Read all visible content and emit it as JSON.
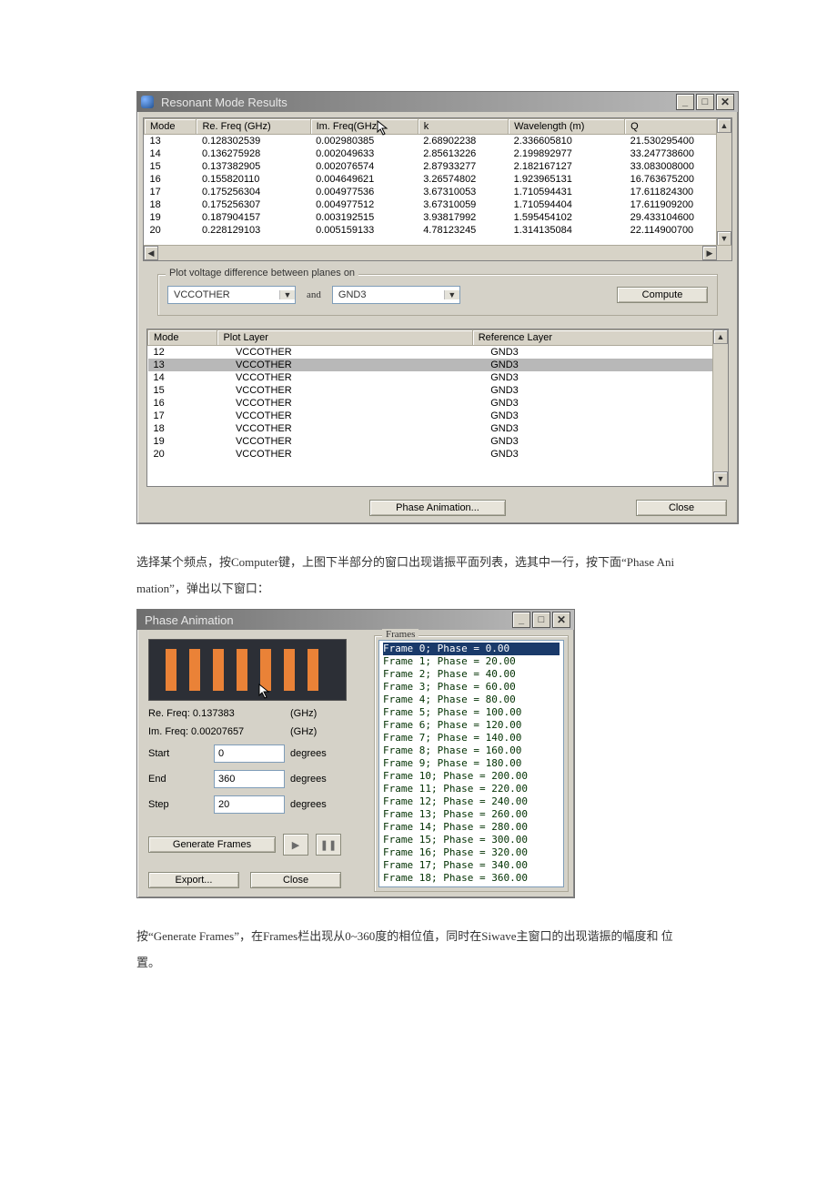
{
  "resonant_window": {
    "title": "Resonant Mode Results",
    "columns": [
      "Mode",
      "Re. Freq (GHz)",
      "Im. Freq(GHz)",
      "k",
      "Wavelength (m)",
      "Q"
    ],
    "rows": [
      [
        "13",
        "0.128302539",
        "0.002980385",
        "2.68902238",
        "2.336605810",
        "21.530295400"
      ],
      [
        "14",
        "0.136275928",
        "0.002049633",
        "2.85613226",
        "2.199892977",
        "33.247738600"
      ],
      [
        "15",
        "0.137382905",
        "0.002076574",
        "2.87933277",
        "2.182167127",
        "33.083008000"
      ],
      [
        "16",
        "0.155820110",
        "0.004649621",
        "3.26574802",
        "1.923965131",
        "16.763675200"
      ],
      [
        "17",
        "0.175256304",
        "0.004977536",
        "3.67310053",
        "1.710594431",
        "17.611824300"
      ],
      [
        "18",
        "0.175256307",
        "0.004977512",
        "3.67310059",
        "1.710594404",
        "17.611909200"
      ],
      [
        "19",
        "0.187904157",
        "0.003192515",
        "3.93817992",
        "1.595454102",
        "29.433104600"
      ],
      [
        "20",
        "0.228129103",
        "0.005159133",
        "4.78123245",
        "1.314135084",
        "22.114900700"
      ]
    ],
    "fieldset_label": "Plot voltage difference between planes on",
    "combo1": "VCCOTHER",
    "and_label": "and",
    "combo2": "GND3",
    "compute_label": "Compute",
    "lower_columns": [
      "Mode",
      "Plot Layer",
      "Reference Layer"
    ],
    "lower_rows": [
      [
        "12",
        "VCCOTHER",
        "GND3"
      ],
      [
        "13",
        "VCCOTHER",
        "GND3"
      ],
      [
        "14",
        "VCCOTHER",
        "GND3"
      ],
      [
        "15",
        "VCCOTHER",
        "GND3"
      ],
      [
        "16",
        "VCCOTHER",
        "GND3"
      ],
      [
        "17",
        "VCCOTHER",
        "GND3"
      ],
      [
        "18",
        "VCCOTHER",
        "GND3"
      ],
      [
        "19",
        "VCCOTHER",
        "GND3"
      ],
      [
        "20",
        "VCCOTHER",
        "GND3"
      ]
    ],
    "selected_lower_index": 1,
    "phase_anim_label": "Phase Animation...",
    "close_label": "Close"
  },
  "doc_paragraph_1a": "选择某个频点，按Computer键，上图下半部分的窗口出现谐振平面列表，选其中一行，按下面“Phase Ani",
  "doc_paragraph_1b": "mation”，弹出以下窗口：",
  "phase_anim_window": {
    "title": "Phase Animation",
    "re_label": "Re. Freq: 0.137383",
    "im_label": "Im. Freq: 0.00207657",
    "ghz": "(GHz)",
    "start_label": "Start",
    "start_value": "0",
    "end_label": "End",
    "end_value": "360",
    "step_label": "Step",
    "step_value": "20",
    "degrees": "degrees",
    "gen_frames_label": "Generate Frames",
    "export_label": "Export...",
    "close_label": "Close",
    "frames_label": "Frames",
    "frames": [
      "Frame 0; Phase = 0.00",
      "Frame 1; Phase = 20.00",
      "Frame 2; Phase = 40.00",
      "Frame 3; Phase = 60.00",
      "Frame 4; Phase = 80.00",
      "Frame 5; Phase = 100.00",
      "Frame 6; Phase = 120.00",
      "Frame 7; Phase = 140.00",
      "Frame 8; Phase = 160.00",
      "Frame 9; Phase = 180.00",
      "Frame 10; Phase = 200.00",
      "Frame 11; Phase = 220.00",
      "Frame 12; Phase = 240.00",
      "Frame 13; Phase = 260.00",
      "Frame 14; Phase = 280.00",
      "Frame 15; Phase = 300.00",
      "Frame 16; Phase = 320.00",
      "Frame 17; Phase = 340.00",
      "Frame 18; Phase = 360.00"
    ],
    "selected_frame_index": 0
  },
  "doc_paragraph_2a": "按“Generate Frames”，在Frames栏出现从0~360度的相位值，同时在Siwave主窗口的出现谐振的幅度和 位",
  "doc_paragraph_2b": "置。",
  "glyphs": {
    "min": "_",
    "max": "□",
    "close": "✕",
    "triUp": "▲",
    "triDown": "▼",
    "triLeft": "◀",
    "triRight": "▶",
    "play": "▶",
    "pause": "❚❚"
  }
}
